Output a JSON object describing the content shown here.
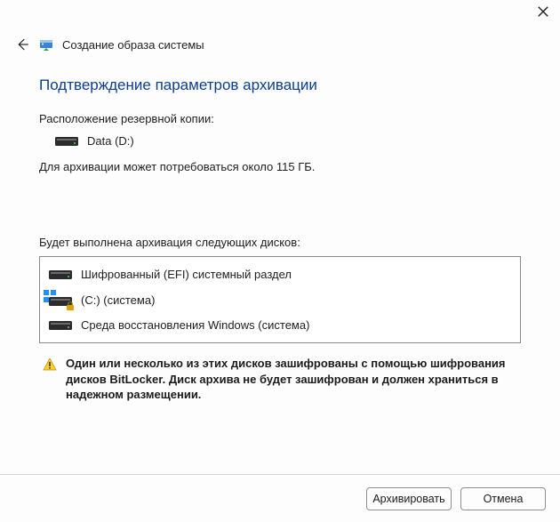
{
  "window": {
    "title": "Создание образа системы"
  },
  "heading": "Подтверждение параметров архивации",
  "backup_location_label": "Расположение резервной копии:",
  "backup_drive": "Data (D:)",
  "size_note": "Для архивации может потребоваться около 115 ГБ.",
  "disk_list_label": "Будет выполнена архивация следующих дисков:",
  "disks": [
    {
      "label": "Шифрованный (EFI) системный раздел"
    },
    {
      "label": "(C:) (система)"
    },
    {
      "label": "Среда восстановления Windows (система)"
    }
  ],
  "warning_text": "Один или несколько из этих дисков зашифрованы с помощью шифрования дисков BitLocker. Диск архива не будет зашифрован и должен храниться в надежном размещении.",
  "buttons": {
    "archive": "Архивировать",
    "cancel": "Отмена"
  }
}
